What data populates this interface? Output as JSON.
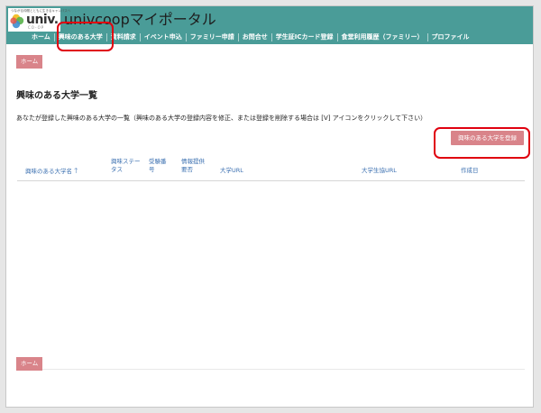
{
  "brand": {
    "tagline": "つながる仲間とともに生きるキャンパスへ",
    "logo_word": "univ.",
    "logo_sub": "CO-OP",
    "site_title": "univcoopマイポータル"
  },
  "nav": {
    "items": [
      {
        "label": "ホーム"
      },
      {
        "label": "興味のある大学"
      },
      {
        "label": "資料請求"
      },
      {
        "label": "イベント申込"
      },
      {
        "label": "ファミリー申請"
      },
      {
        "label": "お問合せ"
      },
      {
        "label": "学生証ICカード登録"
      },
      {
        "label": "食堂利用履歴（ファミリー）"
      },
      {
        "label": "プロファイル"
      }
    ]
  },
  "breadcrumb": {
    "top": "ホーム",
    "bottom": "ホーム"
  },
  "page": {
    "title": "興味のある大学一覧",
    "description": "あなたが登録した興味のある大学の一覧（興味のある大学の登録内容を修正、または登録を削除する場合は [V] アイコンをクリックして下さい）",
    "register_button": "興味のある大学を登録"
  },
  "table": {
    "columns": [
      {
        "line1": "興味のある大学名",
        "line2": "",
        "sorted": "asc"
      },
      {
        "line1": "興味ステー",
        "line2": "タス"
      },
      {
        "line1": "受験番",
        "line2": "号"
      },
      {
        "line1": "情報提供",
        "line2": "要否"
      },
      {
        "line1": "大学URL",
        "line2": ""
      },
      {
        "line1": "大学生協URL",
        "line2": ""
      },
      {
        "line1": "作成日",
        "line2": ""
      }
    ],
    "sort_arrow": "🡑"
  },
  "colors": {
    "header_bg": "#4a9c98",
    "button_bg": "#d9848a",
    "annotation": "#e0000f",
    "link": "#3a6fb0"
  }
}
